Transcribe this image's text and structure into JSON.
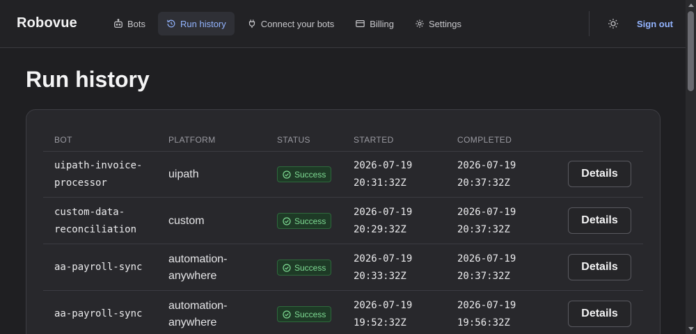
{
  "app": {
    "brand": "Robovue"
  },
  "nav": {
    "items": [
      {
        "label": "Bots",
        "icon": "bot-icon"
      },
      {
        "label": "Run history",
        "icon": "history-icon",
        "active": true
      },
      {
        "label": "Connect your bots",
        "icon": "plug-icon"
      },
      {
        "label": "Billing",
        "icon": "credit-card-icon"
      },
      {
        "label": "Settings",
        "icon": "gear-icon"
      }
    ],
    "theme_toggle_icon": "sun-icon",
    "signout_label": "Sign out"
  },
  "page": {
    "title": "Run history"
  },
  "table": {
    "headers": {
      "bot": "BOT",
      "platform": "PLATFORM",
      "status": "STATUS",
      "started": "STARTED",
      "completed": "COMPLETED"
    },
    "rows": [
      {
        "bot_l1": "uipath-invoice-",
        "bot_l2": "processor",
        "platform_l1": "uipath",
        "platform_l2": "",
        "status": "Success",
        "started_date": "2026-07-19",
        "started_time": "20:31:32Z",
        "completed_date": "2026-07-19",
        "completed_time": "20:37:32Z",
        "action": "Details"
      },
      {
        "bot_l1": "custom-data-",
        "bot_l2": "reconciliation",
        "platform_l1": "custom",
        "platform_l2": "",
        "status": "Success",
        "started_date": "2026-07-19",
        "started_time": "20:29:32Z",
        "completed_date": "2026-07-19",
        "completed_time": "20:37:32Z",
        "action": "Details"
      },
      {
        "bot_l1": "aa-payroll-sync",
        "bot_l2": "",
        "platform_l1": "automation-",
        "platform_l2": "anywhere",
        "status": "Success",
        "started_date": "2026-07-19",
        "started_time": "20:33:32Z",
        "completed_date": "2026-07-19",
        "completed_time": "20:37:32Z",
        "action": "Details"
      },
      {
        "bot_l1": "aa-payroll-sync",
        "bot_l2": "",
        "platform_l1": "automation-",
        "platform_l2": "anywhere",
        "status": "Success",
        "started_date": "2026-07-19",
        "started_time": "19:52:32Z",
        "completed_date": "2026-07-19",
        "completed_time": "19:56:32Z",
        "action": "Details"
      }
    ]
  },
  "colors": {
    "accent": "#93b4ff",
    "success_text": "#7fdc94",
    "success_bg": "#1e3a26",
    "background": "#1f1f22"
  }
}
